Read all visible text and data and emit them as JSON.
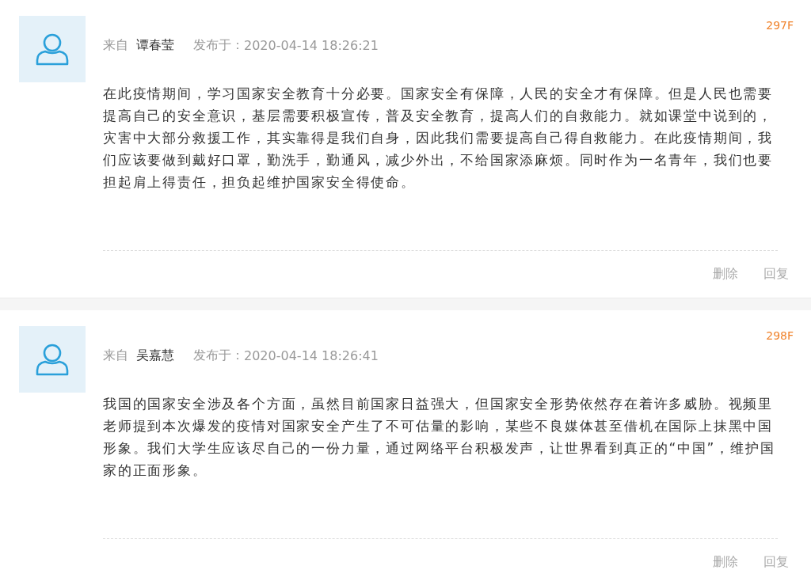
{
  "posts": [
    {
      "floor": "297F",
      "from_label": "来自",
      "author": "谭春莹",
      "posted_label": "发布于：",
      "time": "2020-04-14 18:26:21",
      "body": "在此疫情期间，学习国家安全教育十分必要。国家安全有保障，人民的安全才有保障。但是人民也需要提高自己的安全意识，基层需要积极宣传，普及安全教育，提高人们的自救能力。就如课堂中说到的，灾害中大部分救援工作，其实靠得是我们自身，因此我们需要提高自己得自救能力。在此疫情期间，我们应该要做到戴好口罩，勤洗手，勤通风，减少外出，不给国家添麻烦。同时作为一名青年，我们也要担起肩上得责任，担负起维护国家安全得使命。",
      "actions": [
        "删除",
        "回复"
      ]
    },
    {
      "floor": "298F",
      "from_label": "来自",
      "author": "吴嘉慧",
      "posted_label": "发布于：",
      "time": "2020-04-14 18:26:41",
      "body": "我国的国家安全涉及各个方面，虽然目前国家日益强大，但国家安全形势依然存在着许多威胁。视频里老师提到本次爆发的疫情对国家安全产生了不可估量的影响，某些不良媒体甚至借机在国际上抹黑中国形象。我们大学生应该尽自己的一份力量，通过网络平台积极发声，让世界看到真正的“中国”，维护国家的正面形象。",
      "actions": [
        "删除",
        "回复"
      ]
    }
  ]
}
